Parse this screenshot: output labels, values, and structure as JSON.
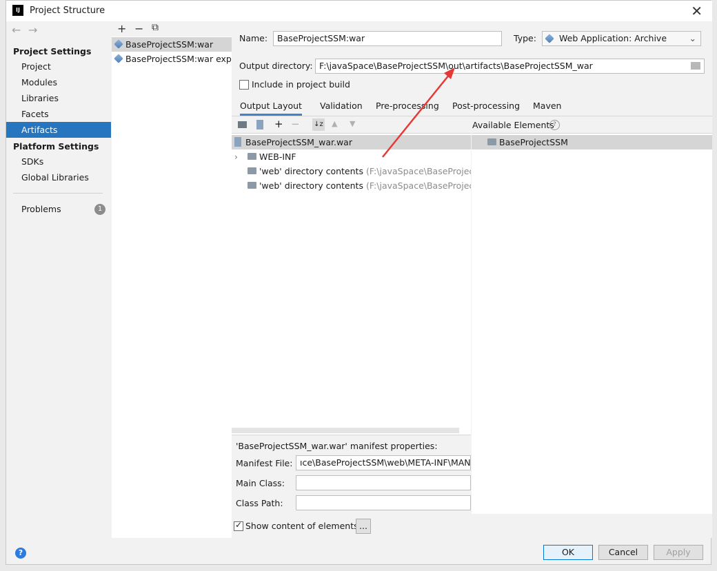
{
  "window": {
    "title": "Project Structure",
    "close_glyph": "✕",
    "app_icon_text": "IJ"
  },
  "nav": {
    "back": "←",
    "forward": "→",
    "project_settings": "Project Settings",
    "items": [
      "Project",
      "Modules",
      "Libraries",
      "Facets",
      "Artifacts"
    ],
    "platform_settings": "Platform Settings",
    "platform_items": [
      "SDKs",
      "Global Libraries"
    ],
    "problems": "Problems",
    "problems_count": "1"
  },
  "artifacts": {
    "toolbar": {
      "add": "+",
      "remove": "−",
      "copy": "⧉"
    },
    "items": [
      "BaseProjectSSM:war",
      "BaseProjectSSM:war exploded"
    ]
  },
  "form": {
    "name_label": "Name:",
    "name_value": "BaseProjectSSM:war",
    "type_label": "Type:",
    "type_value": "Web Application: Archive",
    "output_label": "Output directory:",
    "output_value": "F:\\javaSpace\\BaseProjectSSM\\out\\artifacts\\BaseProjectSSM_war",
    "include_label": "Include in project build"
  },
  "tabs": [
    "Output Layout",
    "Validation",
    "Pre-processing",
    "Post-processing",
    "Maven"
  ],
  "layout": {
    "root": "BaseProjectSSM_war.war",
    "rows": [
      {
        "label": "WEB-INF",
        "detail": ""
      },
      {
        "label": "'web' directory contents",
        "detail": "(F:\\javaSpace\\BaseProjectSSM\\web)"
      },
      {
        "label": "'web' directory contents",
        "detail": "(F:\\javaSpace\\BaseProjectSSM\\web)"
      }
    ],
    "available_label": "Available Elements",
    "available_items": [
      "BaseProjectSSM"
    ]
  },
  "manifest": {
    "title": "'BaseProjectSSM_war.war' manifest properties:",
    "file_label": "Manifest File:",
    "file_value": "ıce\\BaseProjectSSM\\web\\META-INF\\MANIFEST.MF",
    "main_class_label": "Main Class:",
    "main_class_value": "",
    "class_path_label": "Class Path:",
    "class_path_value": ""
  },
  "show_content_label": "Show content of elements",
  "ellipsis_button": "...",
  "buttons": {
    "ok": "OK",
    "cancel": "Cancel",
    "apply": "Apply"
  },
  "help_glyph": "?",
  "colors": {
    "selection": "#2675bf",
    "accent_annotation": "#e53935"
  }
}
